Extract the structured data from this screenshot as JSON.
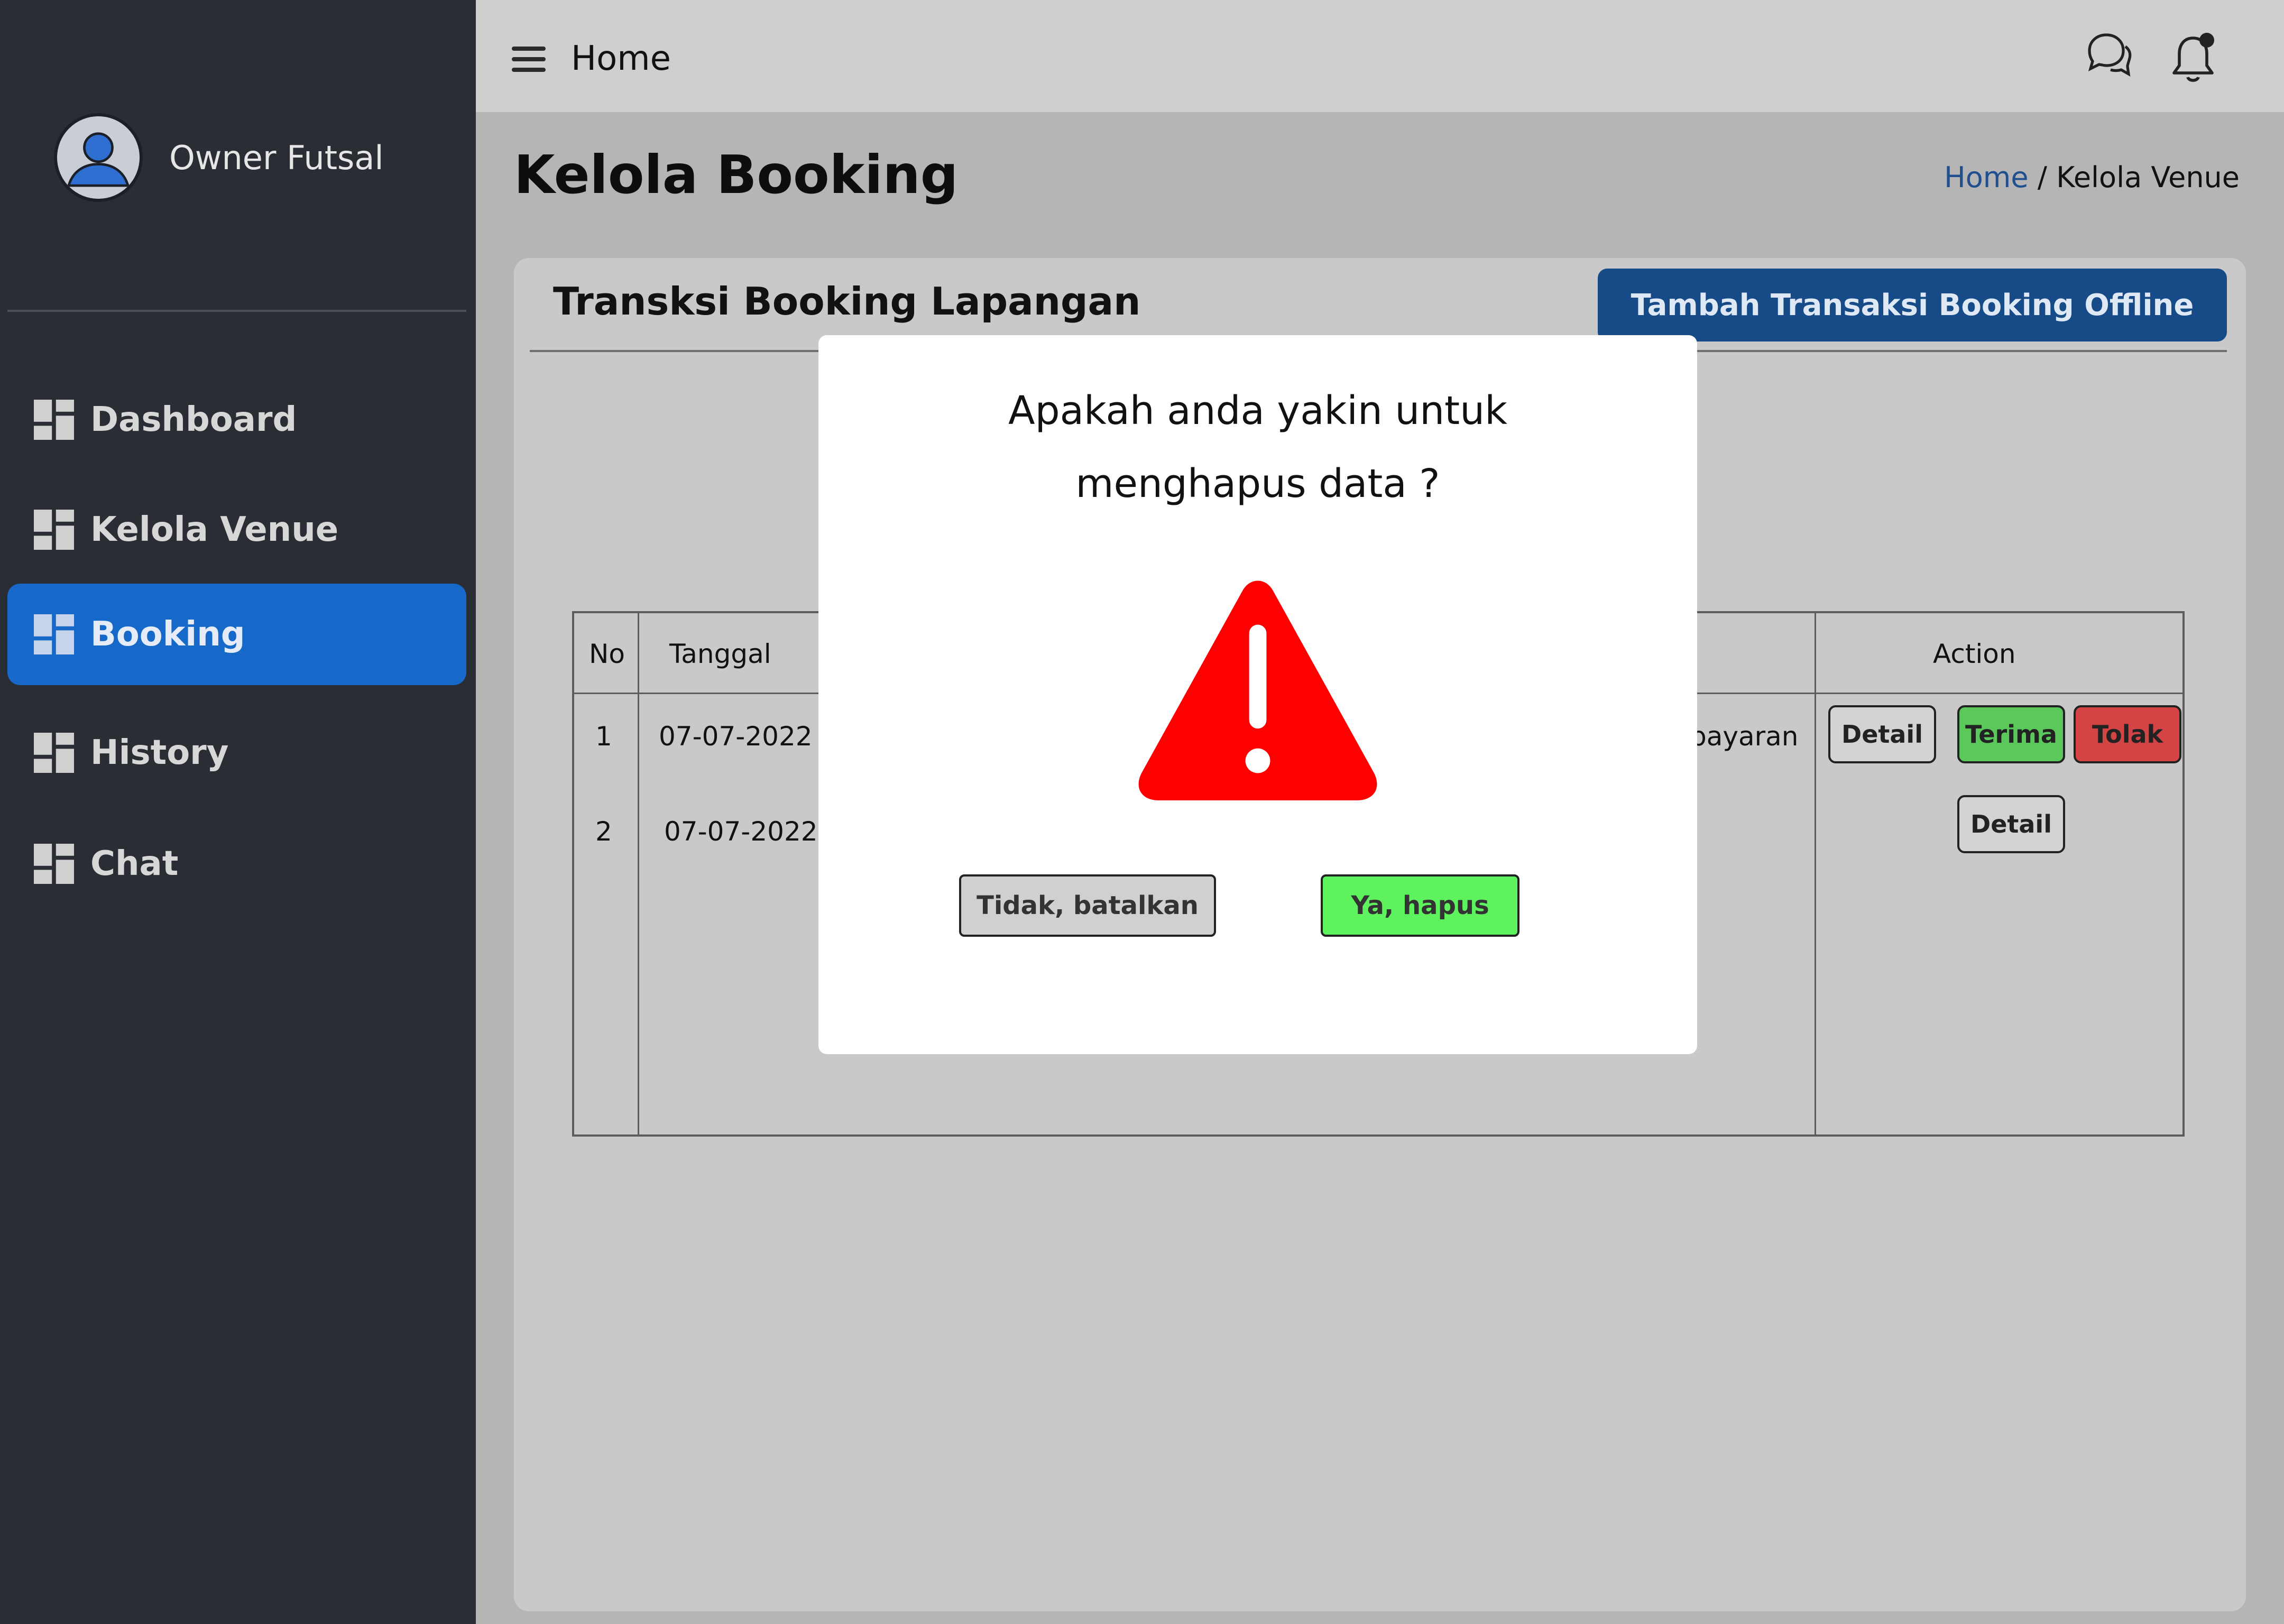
{
  "sidebar": {
    "user_name": "Owner Futsal",
    "items": [
      {
        "label": "Dashboard",
        "active": false
      },
      {
        "label": "Kelola Venue",
        "active": false
      },
      {
        "label": "Booking",
        "active": true
      },
      {
        "label": "History",
        "active": false
      },
      {
        "label": "Chat",
        "active": false
      }
    ]
  },
  "topbar": {
    "title": "Home",
    "icons": [
      "menu-icon",
      "chat-icon",
      "bell-icon"
    ]
  },
  "page": {
    "title": "Kelola Booking",
    "breadcrumb": {
      "home": "Home",
      "separator": "/",
      "current": "Kelola Venue"
    }
  },
  "card": {
    "title": "Transksi Booking Lapangan",
    "add_button": "Tambah Transaksi Booking Offline"
  },
  "table": {
    "headers": {
      "no": "No",
      "tanggal": "Tanggal",
      "action": "Action"
    },
    "partial_cell": "payaran",
    "rows": [
      {
        "no": "1",
        "tanggal": "07-07-2022",
        "actions": [
          "Detail",
          "Terima",
          "Tolak"
        ]
      },
      {
        "no": "2",
        "tanggal": "07-07-2022",
        "actions": [
          "Detail"
        ]
      }
    ]
  },
  "modal": {
    "question_line1": "Apakah anda yakin untuk",
    "question_line2": "menghapus data ?",
    "cancel_label": "Tidak, batalkan",
    "confirm_label": "Ya, hapus"
  },
  "colors": {
    "sidebar_bg": "#2a2d33",
    "active_nav": "#1769c9",
    "primary_button": "#164b88",
    "accept": "#5ac85a",
    "reject": "#d34444",
    "confirm": "#5ff25f",
    "warning": "#ff0000"
  }
}
